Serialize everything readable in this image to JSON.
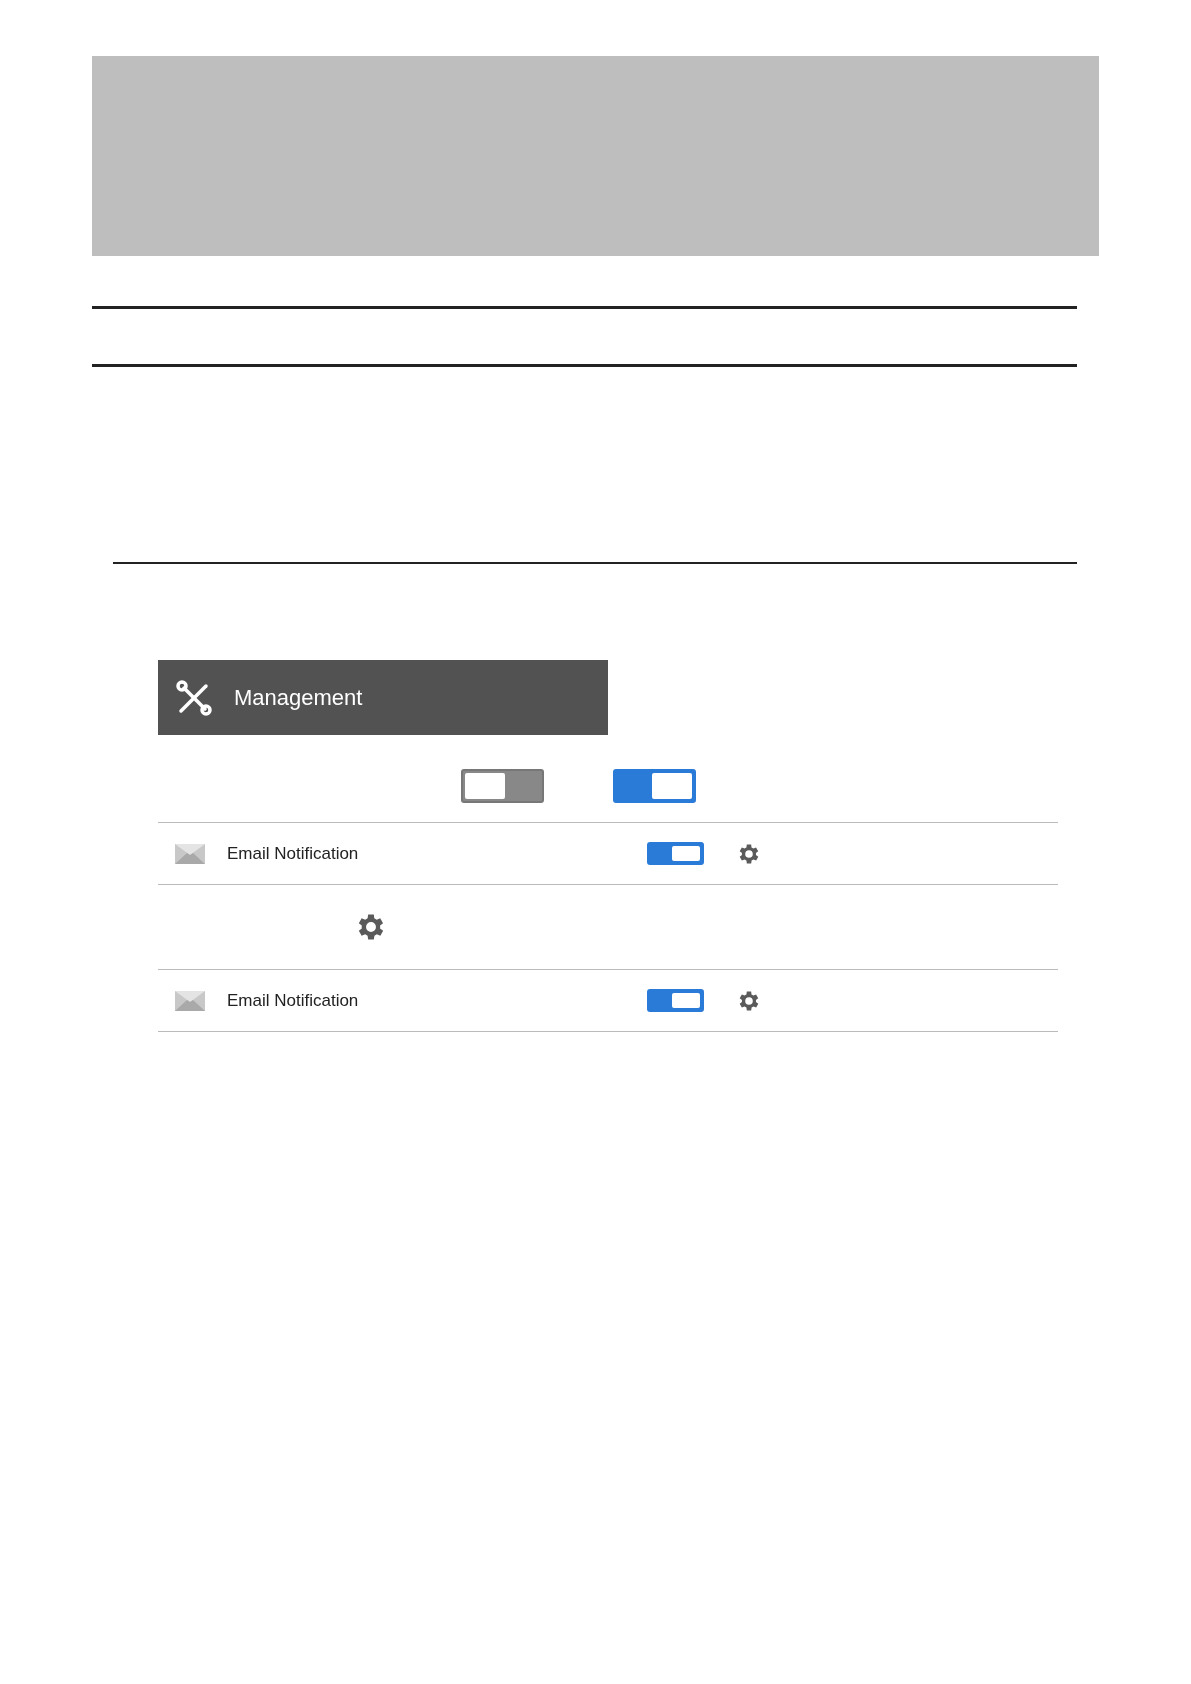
{
  "header": {
    "title": "Management"
  },
  "legend_toggles": [
    {
      "on": false
    },
    {
      "on": true
    }
  ],
  "rows": [
    {
      "kind": "notification",
      "label": "Email Notification",
      "on": true
    },
    {
      "kind": "settings"
    },
    {
      "kind": "notification",
      "label": "Email Notification",
      "on": true
    }
  ]
}
